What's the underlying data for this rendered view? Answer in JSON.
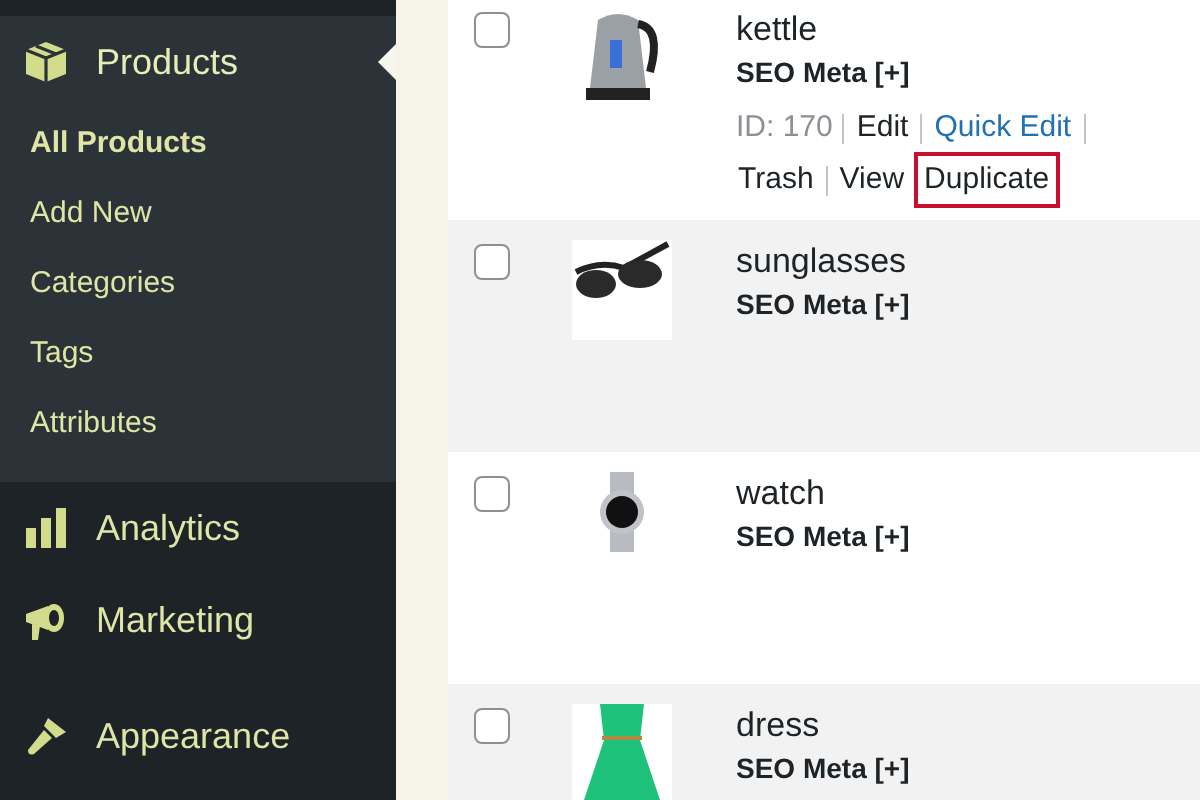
{
  "sidebar": {
    "menu": [
      {
        "label": "Products",
        "current": true,
        "children": [
          {
            "label": "All Products",
            "selected": true
          },
          {
            "label": "Add New",
            "selected": false
          },
          {
            "label": "Categories",
            "selected": false
          },
          {
            "label": "Tags",
            "selected": false
          },
          {
            "label": "Attributes",
            "selected": false
          }
        ]
      },
      {
        "label": "Analytics",
        "current": false
      },
      {
        "label": "Marketing",
        "current": false
      },
      {
        "label": "Appearance",
        "current": false
      }
    ]
  },
  "products": [
    {
      "name": "kettle",
      "checked": false,
      "meta": "SEO Meta [+]",
      "id_label": "ID: 170",
      "actions": [
        {
          "label": "Edit",
          "kind": "plain",
          "highlighted": false
        },
        {
          "label": "Quick Edit",
          "kind": "link",
          "highlighted": false
        },
        {
          "label": "Trash",
          "kind": "plain",
          "highlighted": false
        },
        {
          "label": "View",
          "kind": "plain",
          "highlighted": false
        },
        {
          "label": "Duplicate",
          "kind": "plain",
          "highlighted": true
        }
      ]
    },
    {
      "name": "sunglasses",
      "checked": false,
      "meta": "SEO Meta [+]"
    },
    {
      "name": "watch",
      "checked": false,
      "meta": "SEO Meta [+]"
    },
    {
      "name": "dress",
      "checked": false,
      "meta": "SEO Meta [+]"
    }
  ]
}
